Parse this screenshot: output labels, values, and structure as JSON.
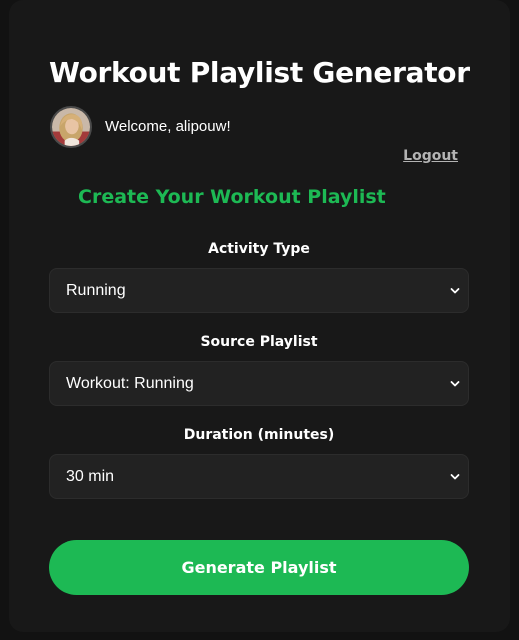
{
  "header": {
    "title": "Workout Playlist Generator"
  },
  "user": {
    "welcome_text": "Welcome, alipouw!",
    "logout_label": "Logout",
    "avatar_icon": "user-avatar-photo"
  },
  "form": {
    "section_title": "Create Your Workout Playlist",
    "activity": {
      "label": "Activity Type",
      "value": "Running"
    },
    "source": {
      "label": "Source Playlist",
      "value": "Workout: Running"
    },
    "duration": {
      "label": "Duration (minutes)",
      "value": "30 min"
    },
    "generate_label": "Generate Playlist"
  },
  "colors": {
    "accent": "#1db954",
    "background": "#121212",
    "card": "#181818",
    "input_bg": "#222222",
    "muted_text": "#b3b3b3"
  },
  "icons": {
    "dropdown": "chevron-down-icon"
  }
}
